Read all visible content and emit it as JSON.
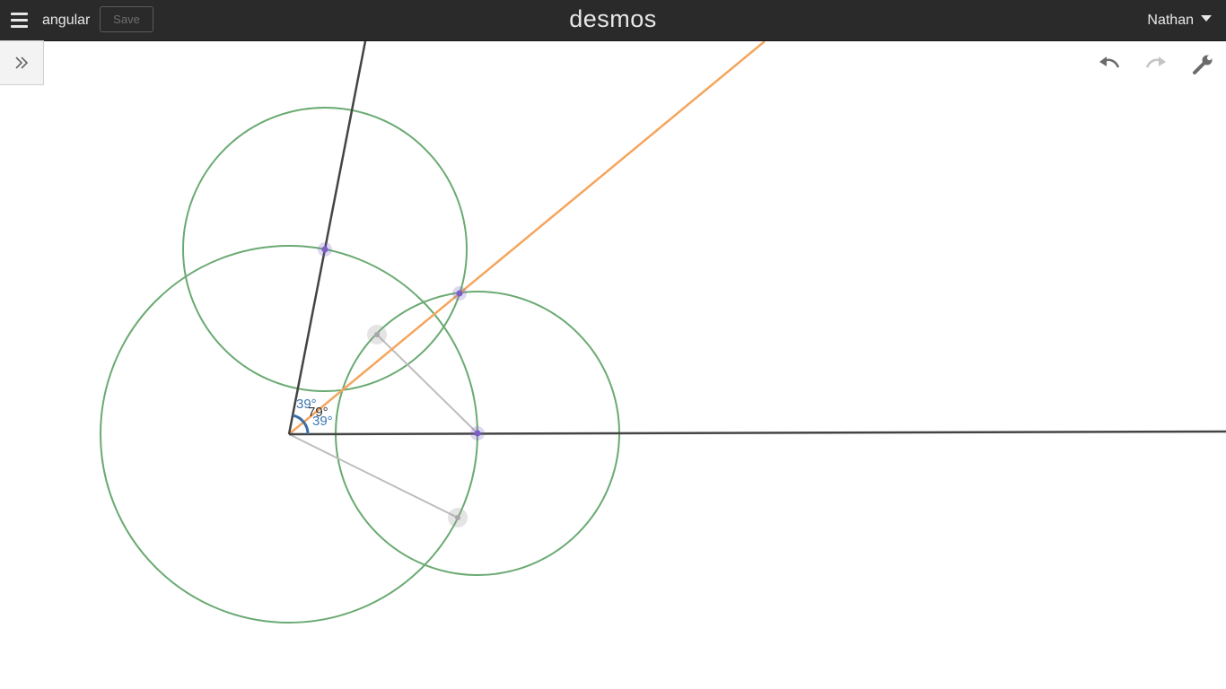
{
  "header": {
    "graph_title": "angular",
    "save_label": "Save",
    "logo": "desmos",
    "user_name": "Nathan"
  },
  "icons": {
    "menu": "hamburger-menu-icon",
    "expand": "double-chevron-right-icon",
    "undo": "undo-icon",
    "redo": "redo-icon",
    "settings": "wrench-icon"
  },
  "colors": {
    "topbar": "#2a2a2a",
    "circle": "#6aaa72",
    "bisector": "#f5a55d",
    "ray": "#444444",
    "point": "#7b5fc7",
    "helper": "#bdbdbd",
    "angle_label": "#3b76b0"
  },
  "graph": {
    "angle_label_upper": "39°",
    "angle_label_middle": "79°",
    "angle_label_lower": "39°"
  }
}
